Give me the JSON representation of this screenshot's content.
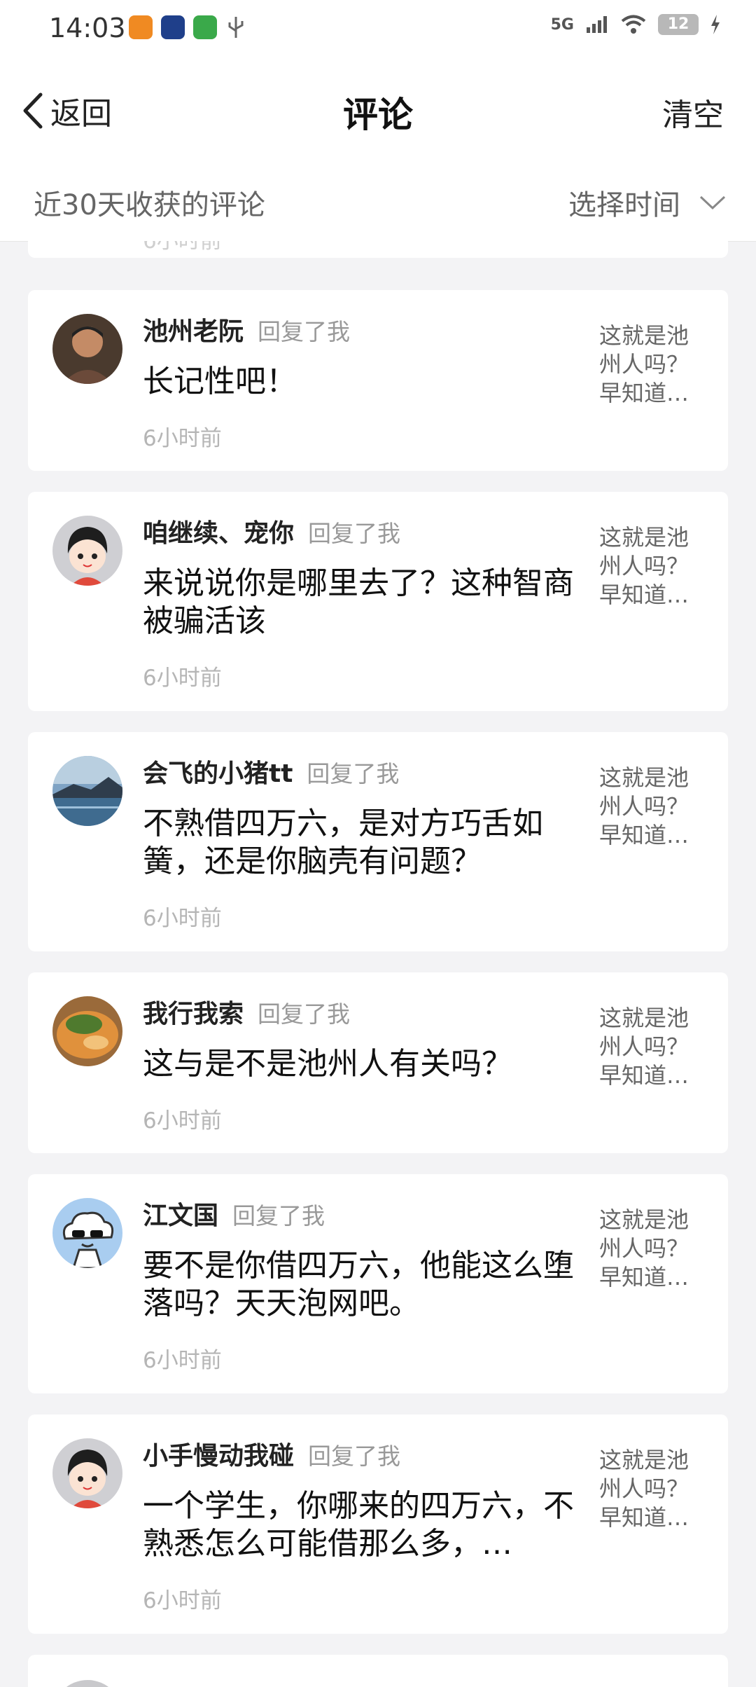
{
  "status": {
    "time": "14:03",
    "network": "5G",
    "battery": "12"
  },
  "header": {
    "back_label": "返回",
    "title": "评论",
    "clear_label": "清空"
  },
  "filter": {
    "label": "近30天收获的评论",
    "select_label": "选择时间"
  },
  "top_partial": {
    "time": "6小时前"
  },
  "comments": [
    {
      "user": "池州老阮",
      "action": "回复了我",
      "text": "长记性吧！",
      "time": "6小时前",
      "ref": [
        "这就是池",
        "州人吗？",
        "早知道…"
      ]
    },
    {
      "user": "咱继续、宠你",
      "action": "回复了我",
      "text": "来说说你是哪里去了？这种智商被骗活该",
      "time": "6小时前",
      "ref": [
        "这就是池",
        "州人吗？",
        "早知道…"
      ]
    },
    {
      "user": "会飞的小猪tt",
      "action": "回复了我",
      "text": "不熟借四万六，是对方巧舌如簧，还是你脑壳有问题？",
      "time": "6小时前",
      "ref": [
        "这就是池",
        "州人吗？",
        "早知道…"
      ]
    },
    {
      "user": "我行我索",
      "action": "回复了我",
      "text": "这与是不是池州人有关吗？",
      "time": "6小时前",
      "ref": [
        "这就是池",
        "州人吗？",
        "早知道…"
      ]
    },
    {
      "user": "江文国",
      "action": "回复了我",
      "text": "要不是你借四万六，他能这么堕落吗？天天泡网吧。",
      "time": "6小时前",
      "ref": [
        "这就是池",
        "州人吗？",
        "早知道…"
      ]
    },
    {
      "user": "小手慢动我碰",
      "action": "回复了我",
      "text": "一个学生，你哪来的四万六，不熟悉怎么可能借那么多，…",
      "time": "6小时前",
      "ref": [
        "这就是池",
        "州人吗？",
        "早知道…"
      ]
    }
  ],
  "colors": {
    "accent_text": "#222222",
    "muted": "#999999",
    "background": "#f3f3f5"
  }
}
